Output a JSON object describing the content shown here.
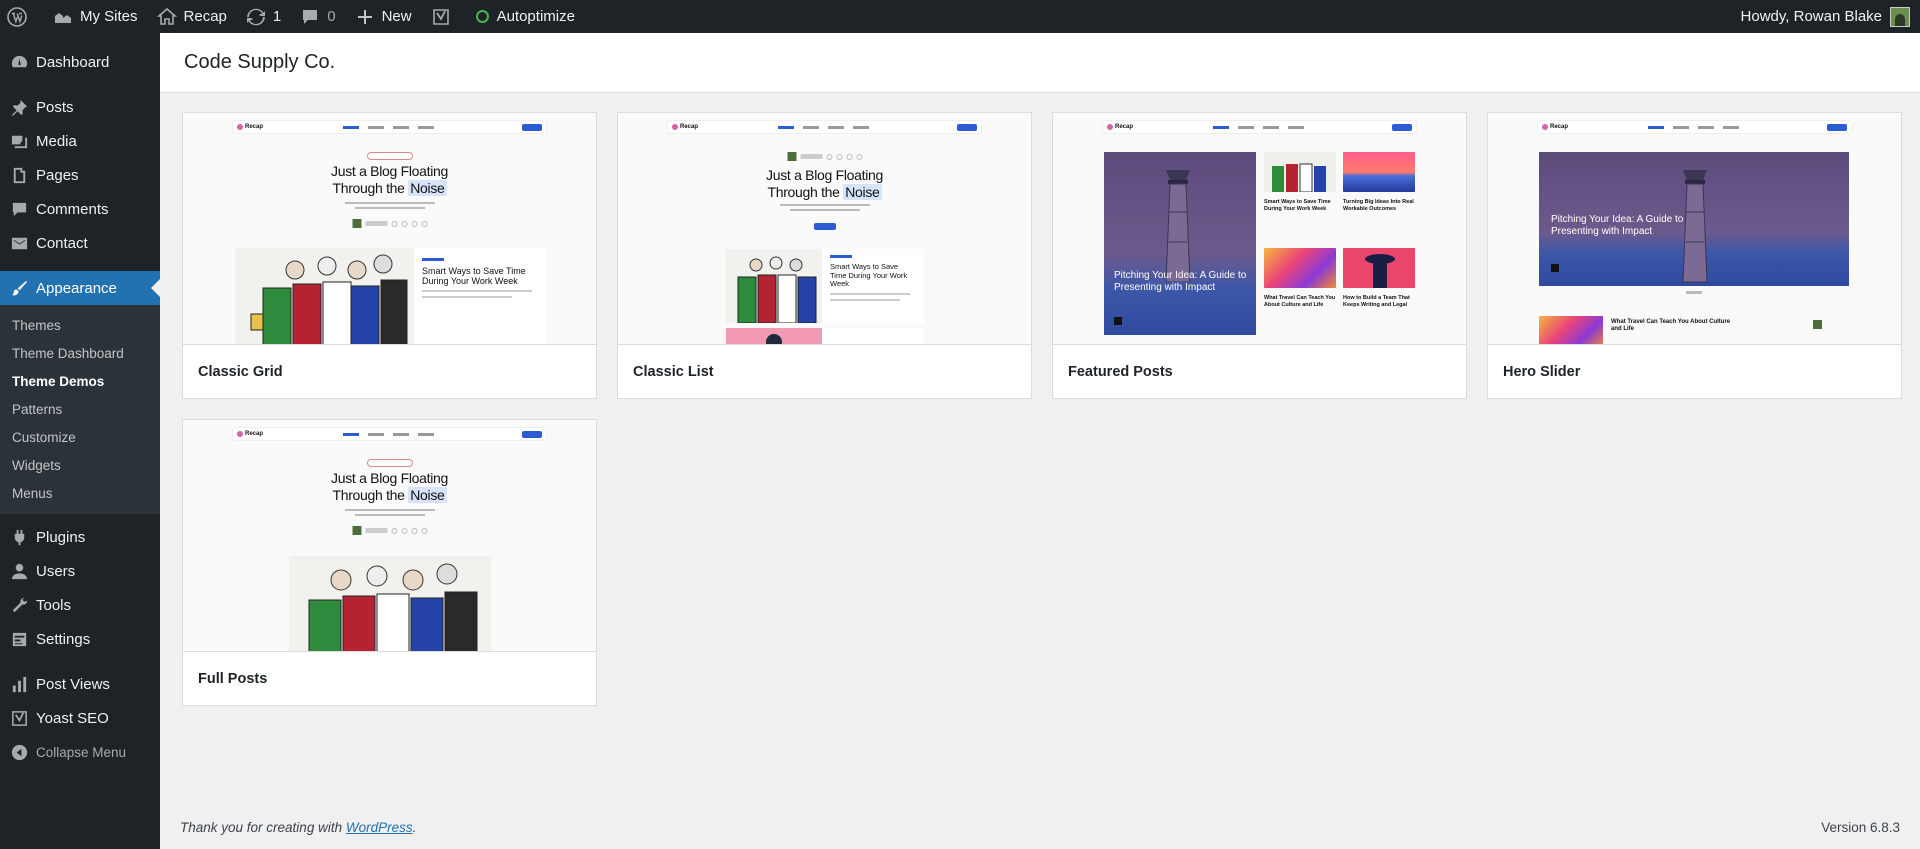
{
  "adminbar": {
    "my_sites": "My Sites",
    "site_name": "Recap",
    "updates_count": "1",
    "comments_count": "0",
    "new_label": "New",
    "autoptimize": "Autoptimize",
    "howdy": "Howdy, Rowan Blake"
  },
  "sidebar": {
    "dashboard": "Dashboard",
    "posts": "Posts",
    "media": "Media",
    "pages": "Pages",
    "comments": "Comments",
    "contact": "Contact",
    "appearance": "Appearance",
    "submenu": [
      "Themes",
      "Theme Dashboard",
      "Theme Demos",
      "Patterns",
      "Customize",
      "Widgets",
      "Menus"
    ],
    "plugins": "Plugins",
    "users": "Users",
    "tools": "Tools",
    "settings": "Settings",
    "post_views": "Post Views",
    "yoast": "Yoast SEO",
    "collapse": "Collapse Menu"
  },
  "page": {
    "title": "Code Supply Co."
  },
  "demos": [
    {
      "name": "Classic Grid"
    },
    {
      "name": "Classic List"
    },
    {
      "name": "Featured Posts"
    },
    {
      "name": "Hero Slider"
    },
    {
      "name": "Full Posts"
    }
  ],
  "preview": {
    "logo": "Recap",
    "hero_line1": "Just a Blog Floating",
    "hero_line2_pre": "Through the ",
    "hero_line2_hl": "Noise",
    "post_title_1": "Smart Ways to Save Time During Your Work Week",
    "feature_title": "Pitching Your Idea: A Guide to Presenting with Impact",
    "side_post_1": "Smart Ways to Save Time During Your Work Week",
    "side_post_2": "Turning Big Ideas Into Real Workable Outcomes",
    "side_post_3": "What Travel Can Teach You About Culture and Life",
    "side_post_4": "How to Build a Team That Keeps Writing and Legal",
    "slider_post": "What Travel Can Teach You About Culture and Life"
  },
  "footer": {
    "thanks_pre": "Thank you for creating with ",
    "wp_link": "WordPress",
    "thanks_post": ".",
    "version": "Version 6.8.3"
  }
}
